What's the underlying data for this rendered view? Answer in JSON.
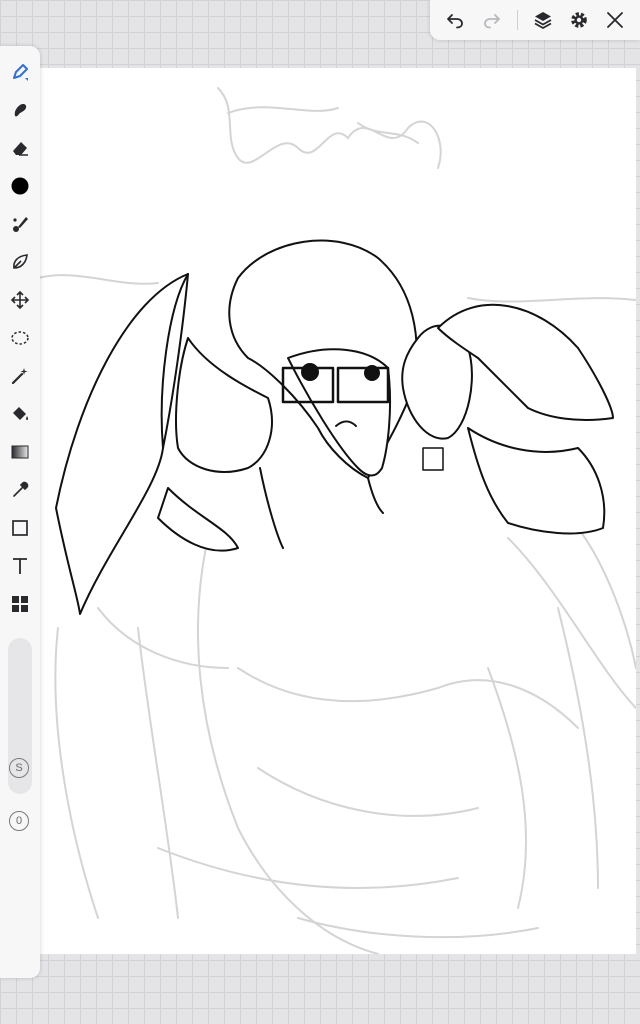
{
  "colors": {
    "accent": "#2f6fe0",
    "icon": "#2a2a2e",
    "icon_disabled": "#b8b8bc",
    "canvas": "#ffffff",
    "workspace": "#e4e4e6"
  },
  "top_bar": {
    "buttons": [
      {
        "name": "undo",
        "icon": "undo-icon",
        "enabled": true
      },
      {
        "name": "redo",
        "icon": "redo-icon",
        "enabled": false
      },
      {
        "name": "layers",
        "icon": "layers-icon",
        "enabled": true
      },
      {
        "name": "settings",
        "icon": "gear-icon",
        "enabled": true
      },
      {
        "name": "close",
        "icon": "close-icon",
        "enabled": true
      }
    ]
  },
  "toolbar": {
    "active_tool": "brush",
    "tools": [
      {
        "name": "brush",
        "icon": "pen-brush-icon"
      },
      {
        "name": "smudge",
        "icon": "smudge-icon"
      },
      {
        "name": "eraser",
        "icon": "eraser-icon"
      },
      {
        "name": "color",
        "icon": "color-swatch-icon",
        "value": "#000000"
      },
      {
        "name": "blend",
        "icon": "blend-brush-icon"
      },
      {
        "name": "shape",
        "icon": "leaf-shape-icon"
      },
      {
        "name": "transform",
        "icon": "move-arrows-icon"
      },
      {
        "name": "lasso",
        "icon": "lasso-select-icon"
      },
      {
        "name": "magic-wand",
        "icon": "magic-wand-icon"
      },
      {
        "name": "fill",
        "icon": "paint-bucket-icon"
      },
      {
        "name": "gradient",
        "icon": "gradient-icon"
      },
      {
        "name": "eyedropper",
        "icon": "eyedropper-icon"
      },
      {
        "name": "rectangle",
        "icon": "rectangle-icon"
      },
      {
        "name": "text",
        "icon": "text-icon"
      },
      {
        "name": "more",
        "icon": "grid-apps-icon"
      }
    ],
    "stabilizer_label": "S",
    "opacity_label": "0"
  }
}
